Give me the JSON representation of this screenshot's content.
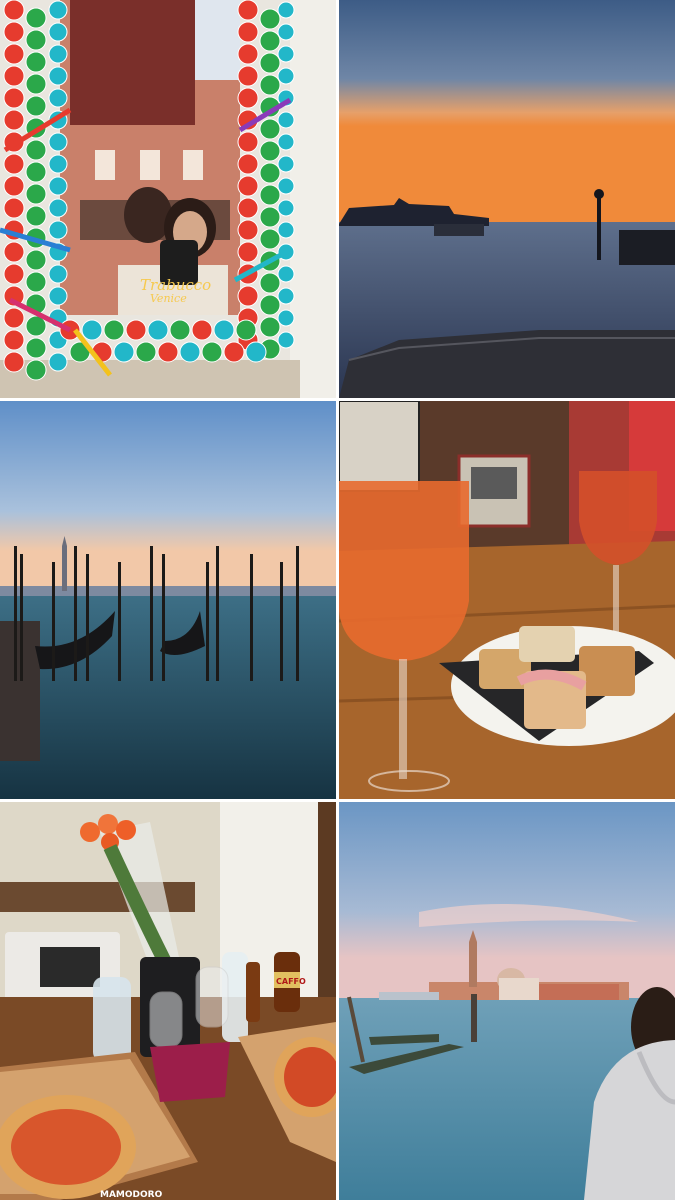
{
  "collage": {
    "tiles": [
      {
        "subject": "mirror-selfie",
        "mirror_sign_line1": "Trabucco",
        "mirror_sign_line2": "Venice"
      },
      {
        "subject": "lagoon-sunset"
      },
      {
        "subject": "gondolas"
      },
      {
        "subject": "spritz-and-cicchetti"
      },
      {
        "subject": "hotel-pizza",
        "bottle_label": "CAFFO",
        "box_print": "MAMODORO"
      },
      {
        "subject": "san-giorgio-view"
      }
    ]
  }
}
